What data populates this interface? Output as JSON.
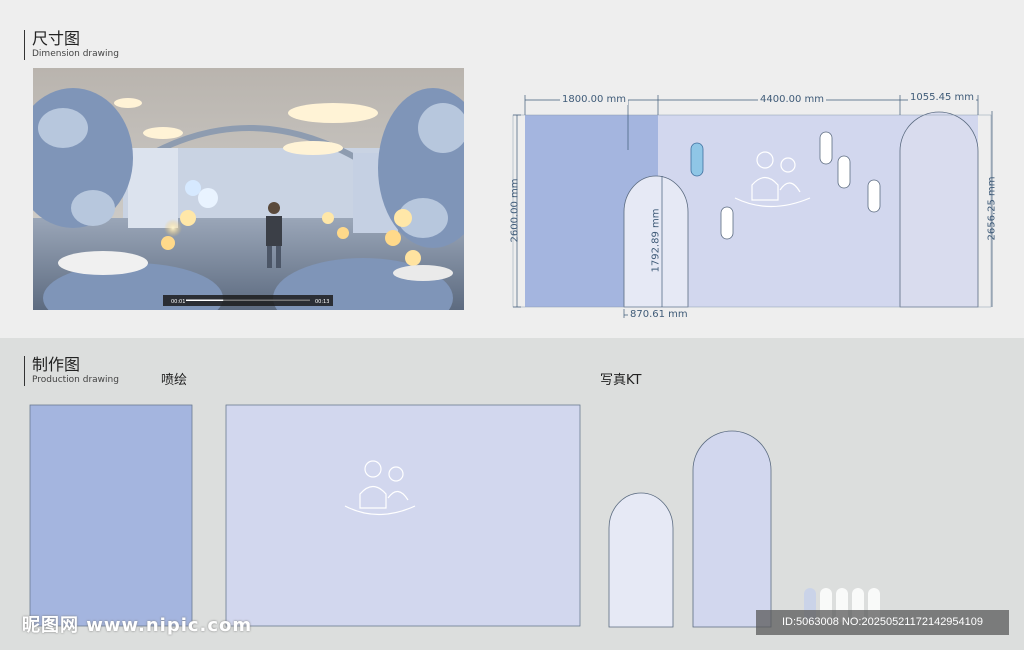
{
  "dimension_section": {
    "title_zh": "尺寸图",
    "title_en": "Dimension drawing"
  },
  "production_section": {
    "title_zh": "制作图",
    "title_en": "Production drawing",
    "label_print": "喷绘",
    "label_kt": "写真KT"
  },
  "video": {
    "time_start": "00:01",
    "time_end": "00:13",
    "progress": 0.3
  },
  "dimensions": {
    "w_left": "1800.00 mm",
    "w_main": "4400.00 mm",
    "w_right": "1055.45 mm",
    "h_left": "2600.00 mm",
    "h_arch": "1792.89 mm",
    "h_right": "2656.25 mm",
    "w_arch": "870.61 mm"
  },
  "colors": {
    "panel_blue": "#a4b5df",
    "panel_lavender": "#d2d7ee",
    "arch_fill": "#e6e9f5",
    "dim_line": "#3f5b78"
  },
  "watermark": {
    "site": "昵图网 www.nipic.com",
    "id_text": "ID:5063008 NO:20250521172142954109"
  }
}
